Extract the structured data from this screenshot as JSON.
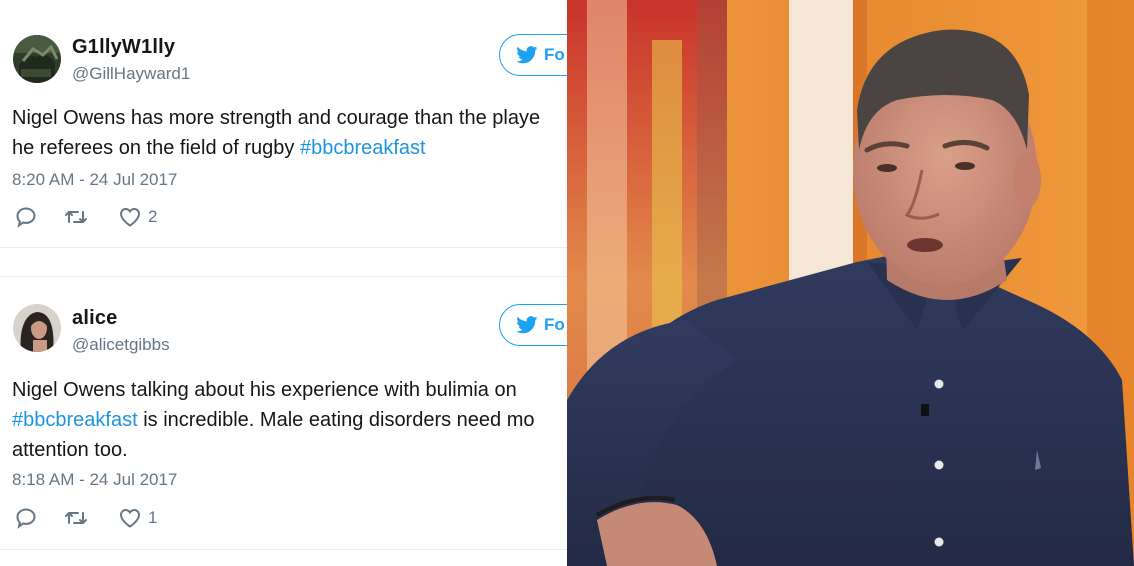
{
  "tweets": [
    {
      "display_name": "G1llyW1lly",
      "handle": "@GillHayward1",
      "follow_label": "Fo",
      "text_line1": "Nigel Owens has more strength and courage than the playe",
      "text_line2_plain": "he referees on the field of rugby ",
      "text_line2_hashtag": "#bbcbreakfast",
      "timestamp": "8:20 AM - 24 Jul 2017",
      "like_count": "2",
      "icons": [
        "reply-icon",
        "retweet-icon",
        "like-icon"
      ]
    },
    {
      "display_name": "alice",
      "handle": "@alicetgibbs",
      "follow_label": "Fo",
      "text_line1": "Nigel Owens talking about his experience with bulimia on",
      "text_line2_hashtag": "#bbcbreakfast",
      "text_line2_plain": " is incredible. Male eating disorders need mo",
      "text_line3": "attention too.",
      "timestamp": "8:18 AM - 24 Jul 2017",
      "like_count": "1",
      "icons": [
        "reply-icon",
        "retweet-icon",
        "like-icon"
      ]
    }
  ],
  "colors": {
    "twitter_blue": "#1da1f2",
    "hashtag": "#1b95e0",
    "secondary_text": "#657786",
    "primary_text": "#14171a",
    "divider": "#e6ecf0",
    "shirt_navy": "#2b3454",
    "studio_orange": "#e8892f"
  }
}
